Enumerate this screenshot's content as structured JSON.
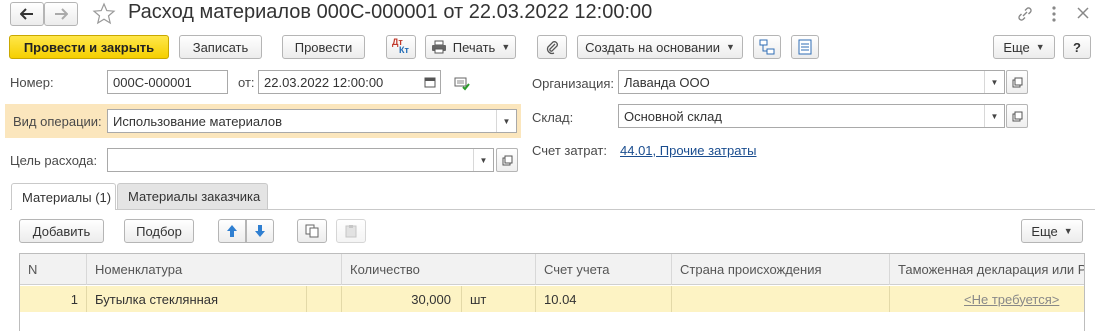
{
  "window": {
    "title": "Расход материалов 000С-000001 от 22.03.2022 12:00:00"
  },
  "toolbar": {
    "post_close": "Провести и закрыть",
    "save": "Записать",
    "post": "Провести",
    "dtkt_top": "Дт",
    "dtkt_bottom": "Кт",
    "print": "Печать",
    "create_based": "Создать на основании",
    "more": "Еще",
    "help": "?"
  },
  "form": {
    "number_label": "Номер:",
    "number_value": "000С-000001",
    "date_label": "от:",
    "date_value": "22.03.2022 12:00:00",
    "operation_label": "Вид операции:",
    "operation_value": "Использование материалов",
    "purpose_label": "Цель расхода:",
    "purpose_value": "",
    "org_label": "Организация:",
    "org_value": "Лаванда ООО",
    "warehouse_label": "Склад:",
    "warehouse_value": "Основной склад",
    "cost_account_label": "Счет затрат:",
    "cost_account_value": "44.01, Прочие затраты"
  },
  "tabs": [
    {
      "label": "Материалы (1)"
    },
    {
      "label": "Материалы заказчика"
    }
  ],
  "table_toolbar": {
    "add": "Добавить",
    "select": "Подбор",
    "more": "Еще"
  },
  "table": {
    "headers": [
      "N",
      "Номенклатура",
      "Количество",
      "Счет учета",
      "Страна происхождения",
      "Таможенная декларация или Р"
    ],
    "rows": [
      {
        "n": "1",
        "item": "Бутылка стеклянная",
        "qty": "30,000",
        "unit": "шт",
        "account": "10.04",
        "country": "",
        "customs": "<Не требуется>"
      }
    ]
  },
  "colors": {
    "primary_button": "#f5cf00",
    "highlight_row": "#fdf3c4",
    "operation_highlight": "#fbe6bd",
    "link": "#1a4d8f"
  }
}
